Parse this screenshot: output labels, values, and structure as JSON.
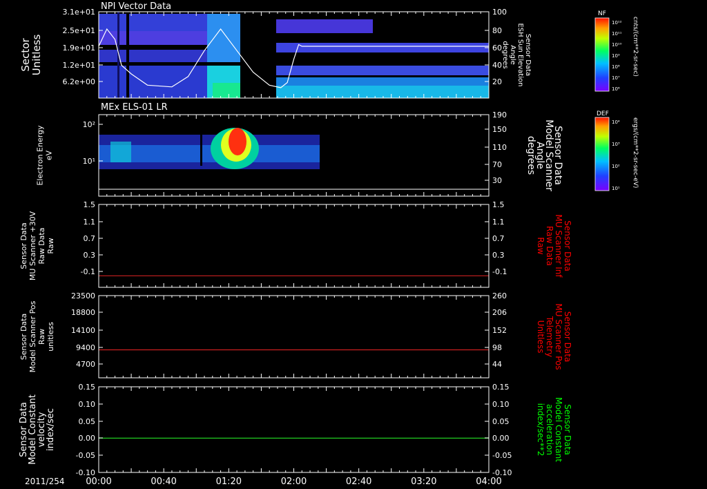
{
  "date_label": "2011/254",
  "time_labels": [
    "00:00",
    "00:40",
    "01:20",
    "02:00",
    "02:40",
    "03:20",
    "04:00"
  ],
  "colors": {
    "red_label": "#ff0000",
    "green_label": "#00ff00",
    "red_line": "#cc2020",
    "green_line": "#22cc22",
    "axis": "#ffffff"
  },
  "colorbars": [
    {
      "title": "NF",
      "unit": "cnts/(cm**2-sr-sec)",
      "ticks": [
        "10¹²",
        "10¹¹",
        "10¹⁰",
        "10⁹",
        "10⁸",
        "10⁷",
        "10⁶"
      ]
    },
    {
      "title": "DEF",
      "unit": "ergs/(cm**2-sr-sec-eV)",
      "ticks": [
        "10⁴",
        "10³",
        "10²",
        "10¹"
      ]
    }
  ],
  "chart_data": [
    {
      "type": "heatmap",
      "title": "NPI Vector Data",
      "ylabel": [
        "Sector",
        "Unitless"
      ],
      "left_ticks": [
        "3.1e+01",
        "2.5e+01",
        "1.9e+01",
        "1.2e+01",
        "6.2e+00"
      ],
      "right_ticks": [
        "100",
        "80",
        "60",
        "40",
        "20"
      ],
      "right_label": [
        "Sensor Data",
        "ESH Sun Elevation",
        "Angle",
        "degrees"
      ],
      "ylim_right": [
        0,
        100
      ],
      "overlay_line": {
        "name": "ESH Sun Elevation Angle",
        "x_minutes": [
          0,
          5,
          10,
          14,
          20,
          30,
          45,
          55,
          65,
          75,
          85,
          95,
          105,
          112,
          116,
          120,
          123,
          125
        ],
        "values": [
          60,
          80,
          68,
          38,
          28,
          15,
          13,
          25,
          55,
          80,
          55,
          30,
          15,
          12,
          18,
          45,
          62,
          60
        ]
      },
      "data_gap_minutes": [
        95,
        118
      ]
    },
    {
      "type": "heatmap",
      "title": "MEx ELS-01 LR",
      "ylabel": [
        "Electron Energy",
        "eV"
      ],
      "left_ticks": [
        "10²",
        "10¹"
      ],
      "right_ticks": [
        "190",
        "150",
        "110",
        "70",
        "30"
      ],
      "right_label": [
        "Sensor Data",
        "Model Scanner",
        "Angle",
        "degrees"
      ],
      "ylim_right": [
        0,
        190
      ],
      "overlay_line": {
        "name": "Model Scanner Angle",
        "x_minutes": [
          0,
          240
        ],
        "values": [
          0,
          0
        ]
      },
      "data_end_minutes": 150
    },
    {
      "type": "line",
      "ylabel": [
        "Sensor Data",
        "MU Scanner +30V",
        "Raw Data",
        "Raw"
      ],
      "left_ticks": [
        "1.5",
        "1.1",
        "0.7",
        "0.3",
        "-0.1"
      ],
      "right_ticks": [
        "1.5",
        "1.1",
        "0.7",
        "0.3",
        "-0.1"
      ],
      "right_label": [
        "Sensor Data",
        "MU Scanner Inf",
        "Raw Data",
        "Raw"
      ],
      "ylim": [
        -0.3,
        1.5
      ],
      "series": [
        {
          "x_minutes": [
            0,
            240
          ],
          "values": [
            -0.05,
            -0.05
          ]
        }
      ]
    },
    {
      "type": "line",
      "ylabel": [
        "Sensor Data",
        "Model Scanner Pos",
        "Raw",
        "unitless"
      ],
      "left_ticks": [
        "23500",
        "18800",
        "14100",
        "9400",
        "4700"
      ],
      "right_ticks": [
        "260",
        "206",
        "152",
        "98",
        "44"
      ],
      "right_label": [
        "Sensor Data",
        "MU Scanner Pos",
        "Telemetry",
        "Unitless"
      ],
      "ylim": [
        0,
        23500
      ],
      "series": [
        {
          "x_minutes": [
            0,
            240
          ],
          "values": [
            8000,
            8000
          ]
        }
      ]
    },
    {
      "type": "line",
      "ylabel": [
        "Sensor Data",
        "Model Constant",
        "velocity",
        "index/sec"
      ],
      "left_ticks": [
        "0.15",
        "0.10",
        "0.05",
        "0.00",
        "-0.05",
        "-0.10"
      ],
      "right_ticks": [
        "0.15",
        "0.10",
        "0.05",
        "0.00",
        "-0.05",
        "-0.10"
      ],
      "right_label": [
        "Sensor Data",
        "Model Constant",
        "acceleration",
        "index/sec**2"
      ],
      "ylim": [
        -0.1,
        0.15
      ],
      "series": [
        {
          "x_minutes": [
            0,
            240
          ],
          "values": [
            0.0,
            0.0
          ]
        }
      ]
    }
  ]
}
